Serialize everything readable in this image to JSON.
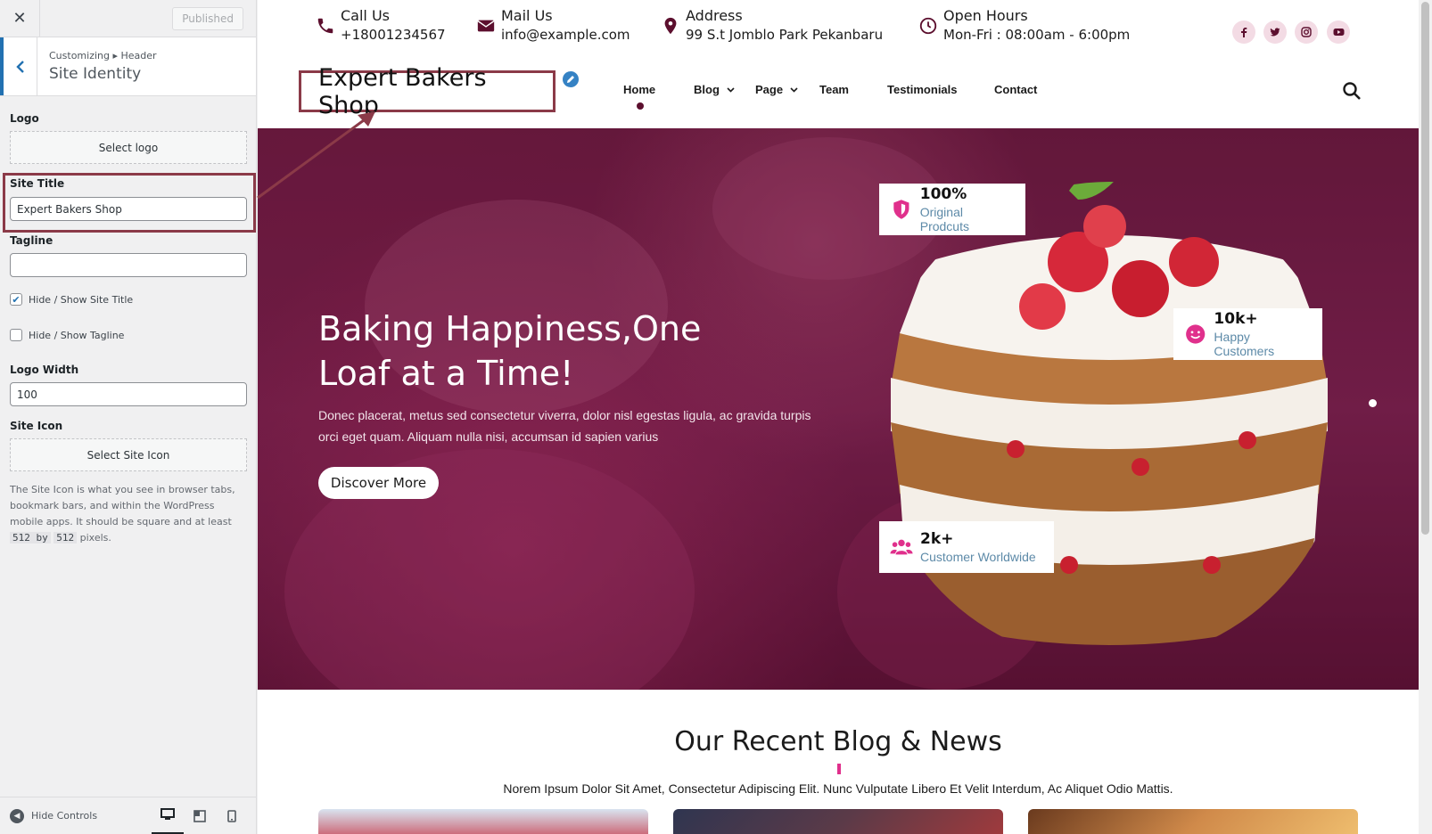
{
  "customizer": {
    "close_label": "✕",
    "publish_label": "Published",
    "breadcrumb": "Customizing ▸ Header",
    "section_title": "Site Identity",
    "logo": {
      "label": "Logo",
      "button": "Select logo"
    },
    "site_title": {
      "label": "Site Title",
      "value": "Expert Bakers Shop"
    },
    "tagline": {
      "label": "Tagline",
      "value": ""
    },
    "hide_show_site_title": {
      "label": "Hide / Show Site Title",
      "checked": true
    },
    "hide_show_tagline": {
      "label": "Hide / Show Tagline",
      "checked": false
    },
    "logo_width": {
      "label": "Logo Width",
      "value": "100"
    },
    "site_icon": {
      "label": "Site Icon",
      "button": "Select Site Icon",
      "description_before": "The Site Icon is what you see in browser tabs, bookmark bars, and within the WordPress mobile apps. It should be square and at least ",
      "code1": "512 by",
      "code2": "512",
      "description_after": " pixels."
    },
    "hide_controls": "Hide Controls",
    "highlight_color": "#8b3a48",
    "accent_color": "#2271b1"
  },
  "preview": {
    "topbar": {
      "call": {
        "title": "Call Us",
        "value": "+18001234567",
        "icon": "phone-icon"
      },
      "mail": {
        "title": "Mail Us",
        "value": "info@example.com",
        "icon": "envelope-icon"
      },
      "address": {
        "title": "Address",
        "value": "99 S.t Jomblo Park Pekanbaru",
        "icon": "map-pin-icon"
      },
      "hours": {
        "title": "Open Hours",
        "value": "Mon-Fri : 08:00am - 6:00pm",
        "icon": "clock-icon"
      },
      "socials": [
        "facebook-icon",
        "twitter-icon",
        "instagram-icon",
        "youtube-icon"
      ]
    },
    "site_title": "Expert Bakers Shop",
    "nav": [
      "Home",
      "Blog",
      "Page",
      "Team",
      "Testimonials",
      "Contact"
    ],
    "hero": {
      "title": "Baking Happiness,One Loaf at a Time!",
      "text": "Donec placerat, metus sed consectetur viverra, dolor nisl egestas ligula, ac gravida turpis orci eget quam. Aliquam nulla nisi, accumsan id sapien varius",
      "button": "Discover More",
      "stats": [
        {
          "number": "100%",
          "label": "Original Prodcuts",
          "icon": "shield-icon"
        },
        {
          "number": "10k+",
          "label": "Happy Customers",
          "icon": "smile-icon"
        },
        {
          "number": "2k+",
          "label": "Customer Worldwide",
          "icon": "users-icon"
        }
      ]
    },
    "blog": {
      "title": "Our Recent Blog & News",
      "subtitle": "Norem Ipsum Dolor Sit Amet, Consectetur Adipiscing Elit. Nunc Vulputate Libero Et Velit Interdum, Ac Aliquet Odio Mattis."
    },
    "brand_color": "#e0308c",
    "hero_color": "#6a1b3f"
  }
}
